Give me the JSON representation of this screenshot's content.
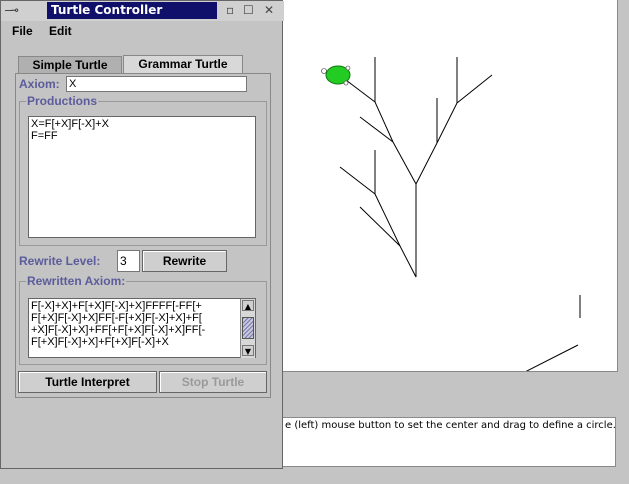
{
  "controller_window": {
    "title": "Turtle Controller",
    "titlebar_left": "—⊸",
    "titlebar_icons": [
      "minimize-icon",
      "maximize-icon",
      "close-icon"
    ]
  },
  "menu": {
    "items": [
      "File",
      "Edit"
    ]
  },
  "tabs": [
    {
      "label": "Simple Turtle",
      "selected": false
    },
    {
      "label": "Grammar Turtle",
      "selected": true
    }
  ],
  "axiom": {
    "label": "Axiom:",
    "value": "X"
  },
  "productions": {
    "label": "Productions",
    "text": "X=F[+X]F[-X]+X\nF=FF"
  },
  "rewrite": {
    "level_label": "Rewrite Level:",
    "level_value": "3",
    "button_label": "Rewrite"
  },
  "rewritten": {
    "label": "Rewritten Axiom:",
    "text": "F[-X]+X]+F[+X]F[-X]+X]FFFF[-FF[+\nF[+X]F[-X]+X]FF[-F[+X]F[-X]+X]+F[\n+X]F[-X]+X]+FF[+F[+X]F[-X]+X]FF[-\nF[+X]F[-X]+X]+F[+X]F[-X]+X"
  },
  "buttons": {
    "interpret": "Turtle Interpret",
    "stop": "Stop Turtle"
  },
  "status_hint": "e (left) mouse button to set the center and drag to define a circle.",
  "colors": {
    "title_bg": "#10106a",
    "label": "#5c5c9c",
    "turtle": "#22cc22"
  }
}
